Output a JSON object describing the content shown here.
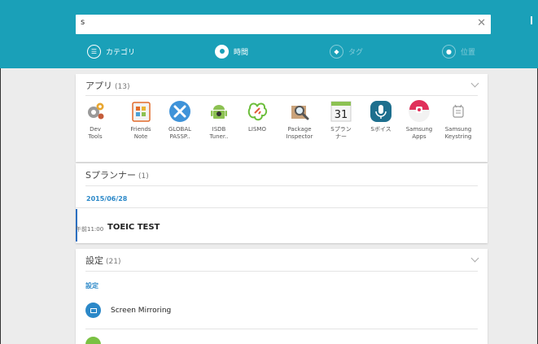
{
  "search": {
    "value": "s"
  },
  "tabs": [
    {
      "label": "カテゴリ",
      "icon": "category-icon",
      "state": "normal"
    },
    {
      "label": "時間",
      "icon": "time-icon",
      "state": "selected"
    },
    {
      "label": "タグ",
      "icon": "tag-icon",
      "state": "disabled"
    },
    {
      "label": "位置",
      "icon": "location-icon",
      "state": "disabled"
    }
  ],
  "apps_section": {
    "title": "アプリ",
    "count": "(13)",
    "apps": [
      {
        "label": "Dev\nTools",
        "icon": "gears-icon"
      },
      {
        "label": "Friends\nNote",
        "icon": "notebook-icon"
      },
      {
        "label": "GLOBAL\nPASSP..",
        "icon": "airplane-icon"
      },
      {
        "label": "ISDB\nTuner..",
        "icon": "android-icon"
      },
      {
        "label": "LISMO",
        "icon": "lismo-icon"
      },
      {
        "label": "Package\nInspector",
        "icon": "magnifier-box-icon"
      },
      {
        "label": "Sプラン\nナー",
        "icon": "calendar-icon",
        "day": "31"
      },
      {
        "label": "Sボイス",
        "icon": "microphone-icon"
      },
      {
        "label": "Samsung\nApps",
        "icon": "samsung-apps-icon"
      },
      {
        "label": "Samsung\nKeystring",
        "icon": "keystring-icon"
      }
    ]
  },
  "planner_section": {
    "title": "Sプランナー",
    "count": "(1)",
    "date": "2015/06/28",
    "event": {
      "time": "午前11:00",
      "title": "TOEIC TEST"
    }
  },
  "settings_section": {
    "title": "設定",
    "count": "(21)",
    "label": "設定",
    "items": [
      {
        "label": "Screen Mirroring",
        "icon": "screen-mirroring-icon"
      }
    ]
  },
  "colors": {
    "accent": "#1aa0b8",
    "link": "#2b88c8"
  }
}
